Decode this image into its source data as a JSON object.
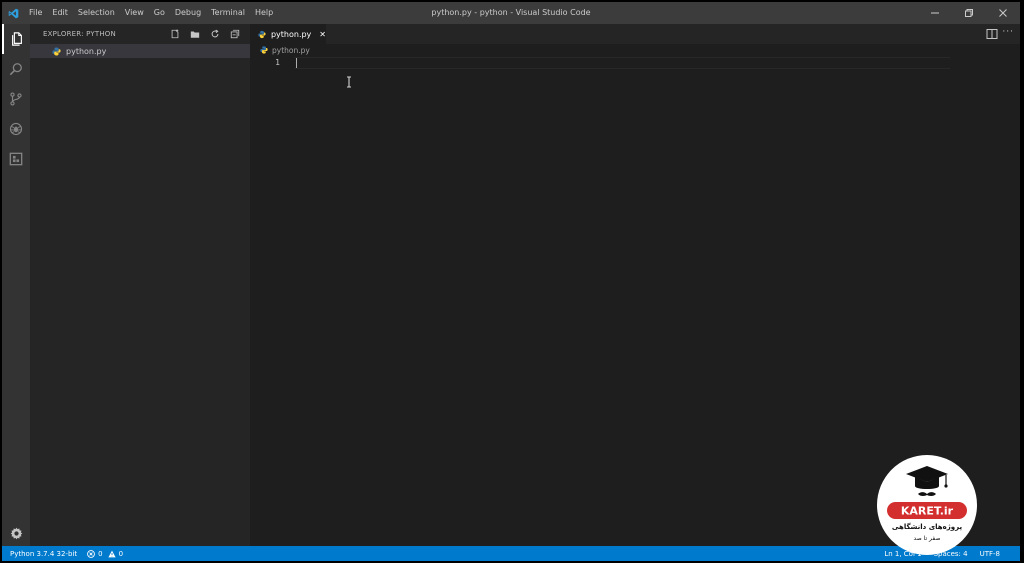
{
  "window": {
    "title": "python.py - python - Visual Studio Code"
  },
  "menu": [
    "File",
    "Edit",
    "Selection",
    "View",
    "Go",
    "Debug",
    "Terminal",
    "Help"
  ],
  "activity_bar": {
    "items": [
      "explorer-icon",
      "search-icon",
      "source-control-icon",
      "debug-icon",
      "extensions-icon"
    ],
    "bottom": "gear-icon",
    "active": "explorer-icon"
  },
  "sidebar": {
    "title": "EXPLORER: PYTHON",
    "actions": [
      "new-file-icon",
      "new-folder-icon",
      "refresh-icon",
      "collapse-all-icon"
    ],
    "files": [
      {
        "name": "python.py",
        "icon": "python-file-icon",
        "selected": true
      }
    ]
  },
  "editor": {
    "tab": {
      "label": "python.py",
      "close": "✕"
    },
    "breadcrumb": "python.py",
    "line_numbers": [
      "1"
    ]
  },
  "statusbar": {
    "interpreter": "Python 3.7.4 32-bit",
    "errors": "0",
    "warnings": "0",
    "position": "Ln 1, Col 1",
    "spaces": "Spaces: 4",
    "encoding": "UTF-8"
  },
  "watermark": {
    "brand": "KARET.ir",
    "tagline": "پروژه‌های دانشگاهی",
    "sub": "صفر تا صد"
  },
  "colors": {
    "accent": "#007acc",
    "titlebar": "#3c3c3c",
    "activitybar": "#333333",
    "sidebar": "#252526",
    "editor": "#1e1e1e",
    "python_blue": "#3572a5",
    "python_yellow": "#ffd43b",
    "watermark_red": "#d32f2f"
  }
}
